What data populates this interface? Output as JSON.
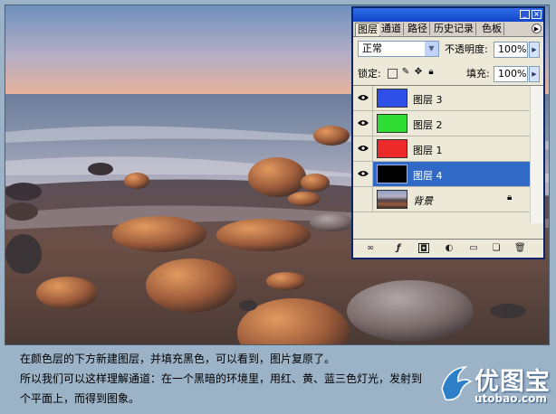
{
  "panel": {
    "tabs": [
      "图层",
      "通道",
      "路径",
      "历史记录",
      "色板"
    ],
    "title_buttons": [
      "_",
      "×"
    ],
    "blend_mode": "正常",
    "opacity_label": "不透明度:",
    "opacity_value": "100%",
    "lock_label": "锁定:",
    "fill_label": "填充:",
    "fill_value": "100%",
    "layers": [
      {
        "name": "图层 3",
        "visible": true,
        "thumb_color": "#2e4fe8",
        "selected": false
      },
      {
        "name": "图层 2",
        "visible": true,
        "thumb_color": "#2fdc34",
        "selected": false
      },
      {
        "name": "图层 1",
        "visible": true,
        "thumb_color": "#ec2a2a",
        "selected": false
      },
      {
        "name": "图层 4",
        "visible": true,
        "thumb_color": "#000000",
        "selected": true
      },
      {
        "name": "背景",
        "visible": false,
        "thumb_color": "photo",
        "selected": false
      }
    ]
  },
  "caption": {
    "line1": "在颜色层的下方新建图层，并填充黑色，可以看到，图片复原了。",
    "line2": "所以我们可以这样理解通道：在一个黑暗的环境里，用红、黄、蓝三色灯光，发射到",
    "line3": "个平面上，而得到图象。"
  },
  "watermark": {
    "brand": "优图宝",
    "url": "utobao.com"
  },
  "colors": {
    "selection": "#3169c6",
    "titlebar": "#1145c9",
    "page_background": "#9bb2c7"
  }
}
